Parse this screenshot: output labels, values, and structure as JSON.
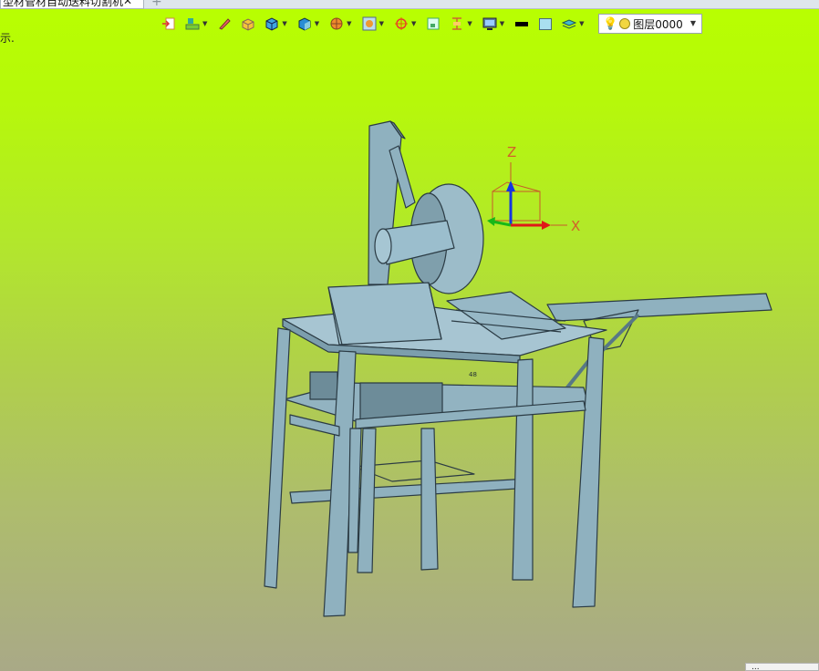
{
  "document_tab": {
    "title": "型材管材自动送料切割机",
    "close_glyph": "✕",
    "add_glyph": "+"
  },
  "hint_text": "示.",
  "toolbar": {
    "icons": [
      "exit-sketch-icon",
      "layer-stack-icon",
      "pencil-icon",
      "solid-box-icon",
      "cube-view-icon",
      "cube-shade-icon",
      "render-mode-icon",
      "frame-view-icon",
      "orientation-icon",
      "small-square-icon",
      "dimension-icon",
      "screen-icon",
      "line-color-swatch",
      "fill-color-swatch",
      "layers-icon"
    ],
    "line_color": "#000000",
    "fill_color": "#a9dff0"
  },
  "layer_selector": {
    "value": "图层0000"
  },
  "triad": {
    "x_label": "X",
    "z_label": "Z"
  },
  "model_label": "48",
  "status_corner_text": "...",
  "colors": {
    "background_top": "#b8ff00",
    "background_bottom": "#a9a987",
    "model_fill": "#8fb1bf",
    "model_stroke": "#2b3b44"
  }
}
